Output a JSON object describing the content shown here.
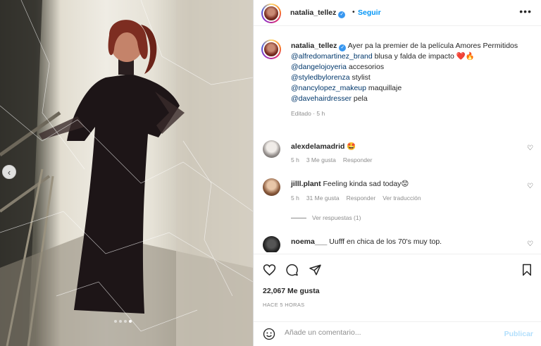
{
  "post": {
    "author": "natalia_tellez",
    "follow_label": "Seguir",
    "separator": "•",
    "more_label": "•••",
    "image_dots": 4,
    "active_dot": 3
  },
  "caption": {
    "username": "natalia_tellez",
    "text": "Ayer pa la premier de la película Amores Permitidos",
    "lines": [
      {
        "mention": "@alfredomartinez_brand",
        "text": " blusa y falda de impacto ❤️🔥"
      },
      {
        "mention": "@dangelojoyeria",
        "text": " accesorios"
      },
      {
        "mention": "@styledbylorenza",
        "text": " stylist"
      },
      {
        "mention": "@nancylopez_makeup",
        "text": " maquillaje"
      },
      {
        "mention": "@davehairdresser",
        "text": " pela"
      }
    ],
    "edited": "Editado · 5 h"
  },
  "comments": [
    {
      "username": "alexdelamadrid",
      "text": "🤩",
      "time": "5 h",
      "likes": "3 Me gusta",
      "reply": "Responder",
      "translate": ""
    },
    {
      "username": "jilll.plant",
      "text": "Feeling kinda sad today😟",
      "time": "5 h",
      "likes": "31 Me gusta",
      "reply": "Responder",
      "translate": "Ver traducción"
    },
    {
      "username": "noema___",
      "text": "Uufff en chica de los 70's muy top.",
      "time": "",
      "likes": "",
      "reply": "",
      "translate": ""
    }
  ],
  "view_replies": "Ver respuestas (1)",
  "likes_text": "22,067 Me gusta",
  "timestamp": "HACE 5 HORAS",
  "add_comment": {
    "placeholder": "Añade un comentario...",
    "post_label": "Publicar"
  },
  "icons": [
    "heart-icon",
    "comment-icon",
    "share-icon",
    "bookmark-icon",
    "emoji-icon",
    "prev-arrow-icon",
    "verified-icon"
  ],
  "colors": {
    "accent": "#0095f6",
    "text": "#262626",
    "muted": "#8e8e8e",
    "mention": "#00376b",
    "post_disabled": "#b2dffc",
    "like_red": "#ed4956"
  }
}
